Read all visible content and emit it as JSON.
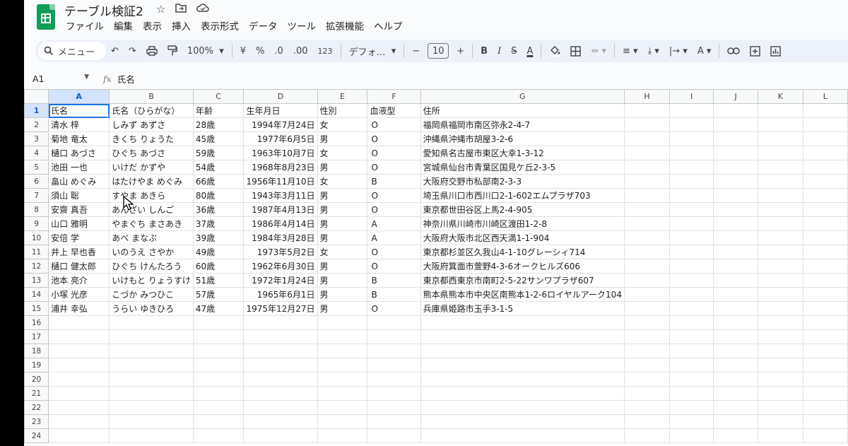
{
  "title": "テーブル検証2",
  "menu": [
    "ファイル",
    "編集",
    "表示",
    "挿入",
    "表示形式",
    "データ",
    "ツール",
    "拡張機能",
    "ヘルプ"
  ],
  "toolbar": {
    "search_label": "メニュー",
    "zoom": "100%",
    "currency": "¥",
    "percent": "%",
    "dec_decrease": ".0",
    "dec_increase": ".00",
    "number_format": "123",
    "font": "デフォ…",
    "font_size": "10"
  },
  "formula": {
    "cell_ref": "A1",
    "fx": "fx",
    "value": "氏名"
  },
  "columns": [
    "A",
    "B",
    "C",
    "D",
    "E",
    "F",
    "G",
    "H",
    "I",
    "J",
    "K",
    "L"
  ],
  "row_numbers": [
    "1",
    "2",
    "3",
    "4",
    "5",
    "6",
    "7",
    "8",
    "9",
    "10",
    "11",
    "12",
    "13",
    "14",
    "15",
    "16",
    "17",
    "18",
    "19",
    "20",
    "21",
    "22",
    "23",
    "24"
  ],
  "headers": [
    "氏名",
    "氏名（ひらがな）",
    "年齢",
    "生年月日",
    "性別",
    "血液型",
    "住所"
  ],
  "rows": [
    [
      "清水 梓",
      "しみず あずさ",
      "28歳",
      "1994年7月24日",
      "女",
      "O",
      "福岡県福岡市南区弥永2-4-7"
    ],
    [
      "菊地 竜太",
      "きくち りょうた",
      "45歳",
      "1977年6月5日",
      "男",
      "O",
      "沖縄県沖縄市胡屋3-2-6"
    ],
    [
      "樋口 あづさ",
      "ひぐち あづさ",
      "59歳",
      "1963年10月7日",
      "女",
      "O",
      "愛知県名古屋市東区大幸1-3-12"
    ],
    [
      "池田 一也",
      "いけだ かずや",
      "54歳",
      "1968年8月23日",
      "男",
      "O",
      "宮城県仙台市青葉区国見ケ丘2-3-5"
    ],
    [
      "畠山 めぐみ",
      "はたけやま めぐみ",
      "66歳",
      "1956年11月10日",
      "女",
      "B",
      "大阪府交野市私部南2-3-3"
    ],
    [
      "須山 聡",
      "すやま あきら",
      "80歳",
      "1943年3月11日",
      "男",
      "O",
      "埼玉県川口市西川口2-1-602エムプラザ703"
    ],
    [
      "安齋 真吾",
      "あんざい しんご",
      "36歳",
      "1987年4月13日",
      "男",
      "O",
      "東京都世田谷区上馬2-4-905"
    ],
    [
      "山口 雅明",
      "やまぐち まさあき",
      "37歳",
      "1986年4月14日",
      "男",
      "A",
      "神奈川県川崎市川崎区渡田1-2-8"
    ],
    [
      "安倍 学",
      "あべ まなぶ",
      "39歳",
      "1984年3月28日",
      "男",
      "A",
      "大阪府大阪市北区西天満1-1-904"
    ],
    [
      "井上 早也香",
      "いのうえ さやか",
      "49歳",
      "1973年5月2日",
      "女",
      "O",
      "東京都杉並区久我山4-1-10グレーシィ714"
    ],
    [
      "樋口 健太郎",
      "ひぐち けんたろう",
      "60歳",
      "1962年6月30日",
      "男",
      "O",
      "大阪府箕面市萱野4-3-6オークヒルズ606"
    ],
    [
      "池本 亮介",
      "いけもと りょうすけ",
      "51歳",
      "1972年1月24日",
      "男",
      "B",
      "東京都西東京市南町2-5-22サンワプラザ607"
    ],
    [
      "小塚 光彦",
      "こづか みつひこ",
      "57歳",
      "1965年6月1日",
      "男",
      "B",
      "熊本県熊本市中央区南熊本1-2-6ロイヤルアーク104"
    ],
    [
      "浦井 幸弘",
      "うらい ゆきひろ",
      "47歳",
      "1975年12月27日",
      "男",
      "O",
      "兵庫県姫路市玉手3-1-5"
    ]
  ]
}
